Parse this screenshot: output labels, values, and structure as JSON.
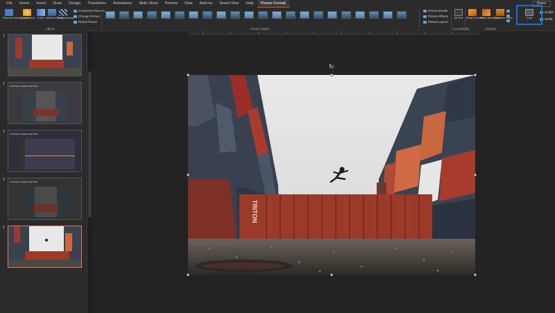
{
  "menu": {
    "items": [
      "File",
      "Home",
      "Insert",
      "Draw",
      "Design",
      "Transitions",
      "Animations",
      "Slide Show",
      "Review",
      "View",
      "Add-ins",
      "Smart View",
      "Help",
      "Picture Format"
    ],
    "share": "Share"
  },
  "ribbon": {
    "adjust": {
      "remove_background": "Remove Background",
      "corrections": "Corrections",
      "color": "Color",
      "artistic_effects": "Artistic Effects",
      "transparency": "Transparency",
      "compress": "Compress Pictures",
      "change": "Change Picture",
      "reset": "Reset Picture",
      "group_label": "Adjust"
    },
    "picture_styles": {
      "group_label": "Picture Styles"
    },
    "picture_options": {
      "border": "Picture Border",
      "effects": "Picture Effects",
      "layout": "Picture Layout"
    },
    "accessibility": {
      "alt_text": "Alt Text",
      "group_label": "Accessibility"
    },
    "arrange": {
      "bring_forward": "Bring Forward",
      "send_backward": "Send Backward",
      "selection_pane": "Selection Pane",
      "group_label": "Arrange"
    },
    "size": {
      "crop": "Crop",
      "height": "Height",
      "width": "Width"
    }
  },
  "slides": [
    {
      "number": "1",
      "title": ""
    },
    {
      "number": "2",
      "title": "Footnotes, Headers and Lists"
    },
    {
      "number": "3",
      "title": "Footnotes, Headers and Lists"
    },
    {
      "number": "4",
      "title": "Footnotes, Headers and Title"
    },
    {
      "number": "5",
      "title": ""
    }
  ],
  "photo": {
    "container_text": "TRITON"
  },
  "colors": {
    "accent": "#c55a11",
    "crop_highlight": "#1f6fd1",
    "selected_thumb_border": "#e07a5a"
  }
}
